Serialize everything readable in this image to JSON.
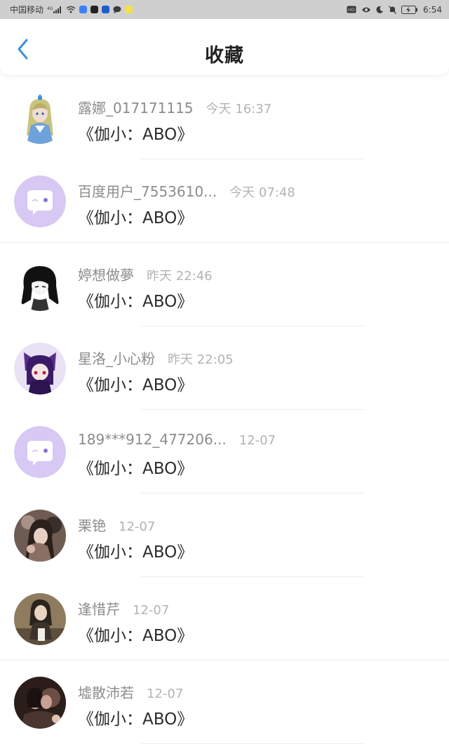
{
  "status_bar": {
    "carrier": "中国移动",
    "network": "4G",
    "time": "6:54",
    "battery_icon": "battery-charging-icon",
    "hd_badge": "HD"
  },
  "header": {
    "title": "收藏",
    "back_icon": "chevron-left-icon"
  },
  "colors": {
    "accent": "#3d8fe0",
    "default_avatar_bg": "#d8c8f4",
    "default_avatar_icon": "#8b6fd9"
  },
  "items": [
    {
      "username": "露娜_017171115",
      "time": "今天 16:37",
      "title": "《伽小：ABO》",
      "avatar": "anime-girl-avatar"
    },
    {
      "username": "百度用户_7553610...",
      "time": "今天 07:48",
      "title": "《伽小：ABO》",
      "avatar": "default-avatar"
    },
    {
      "username": "婷想做夢",
      "time": "昨天 22:46",
      "title": "《伽小：ABO》",
      "avatar": "anime-dark-hair-avatar"
    },
    {
      "username": "星洛_小心粉",
      "time": "昨天 22:05",
      "title": "《伽小：ABO》",
      "avatar": "anime-purple-avatar"
    },
    {
      "username": "189***912_477206...",
      "time": "12-07",
      "title": "《伽小：ABO》",
      "avatar": "default-avatar"
    },
    {
      "username": "栗铯",
      "time": "12-07",
      "title": "《伽小：ABO》",
      "avatar": "photo-avatar"
    },
    {
      "username": "逢惜芹",
      "time": "12-07",
      "title": "《伽小：ABO》",
      "avatar": "photo-avatar"
    },
    {
      "username": "墟散沛若",
      "time": "12-07",
      "title": "《伽小：ABO》",
      "avatar": "photo-avatar"
    }
  ]
}
